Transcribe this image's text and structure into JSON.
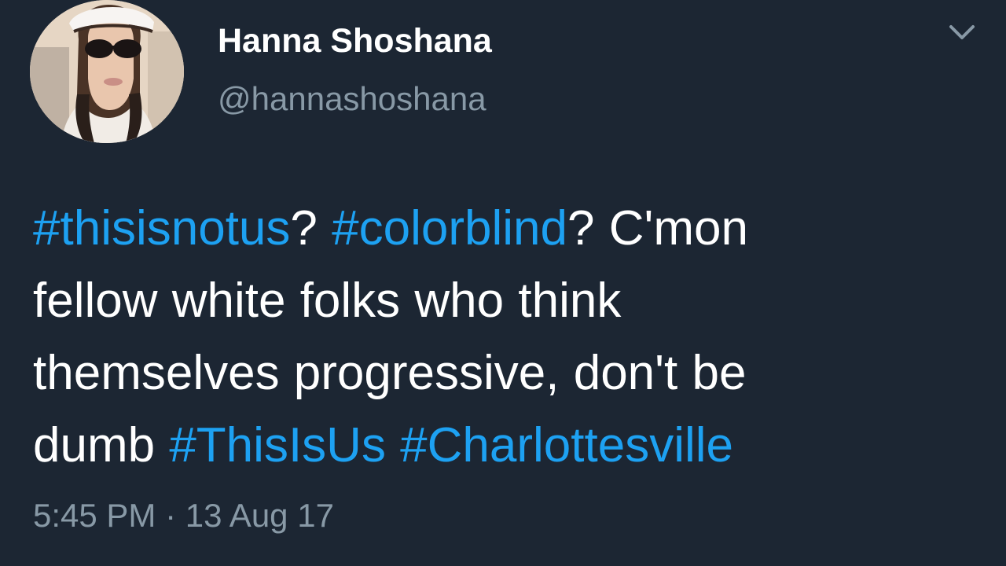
{
  "author": {
    "display_name": "Hanna Shoshana",
    "handle": "@hannashoshana"
  },
  "tweet": {
    "lines": [
      [
        {
          "text": "#thisisnotus",
          "type": "hashtag"
        },
        {
          "text": "? ",
          "type": "text"
        },
        {
          "text": "#colorblind",
          "type": "hashtag"
        },
        {
          "text": "? C'mon",
          "type": "text"
        }
      ],
      [
        {
          "text": "fellow white folks who think",
          "type": "text"
        }
      ],
      [
        {
          "text": "themselves progressive, don't be",
          "type": "text"
        }
      ],
      [
        {
          "text": "dumb ",
          "type": "text"
        },
        {
          "text": "#ThisIsUs",
          "type": "hashtag"
        },
        {
          "text": " ",
          "type": "text"
        },
        {
          "text": "#Charlottesville",
          "type": "hashtag"
        }
      ]
    ],
    "timestamp": "5:45 PM · 13 Aug 17"
  },
  "icons": {
    "menu": "chevron-down-icon",
    "avatar": "profile-photo"
  },
  "colors": {
    "background": "#1c2633",
    "hashtag": "#1da1f2",
    "secondary_text": "#8899a6",
    "primary_text": "#ffffff"
  }
}
